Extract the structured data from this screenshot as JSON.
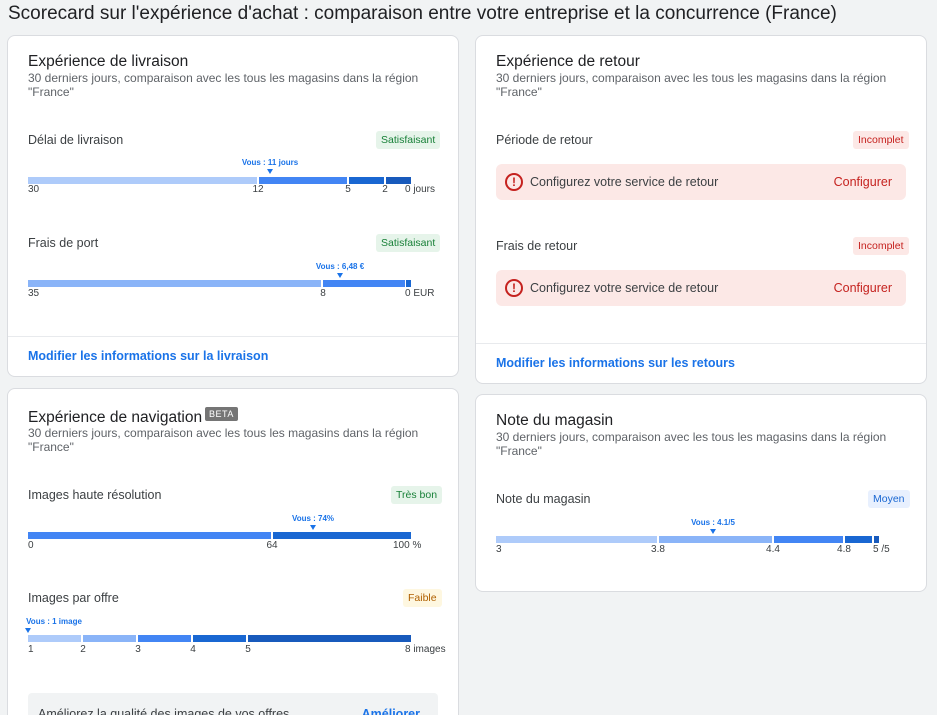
{
  "page_title": "Scorecard sur l'expérience d'achat : comparaison entre votre entreprise et la concurrence (France)",
  "colors": {
    "seg1": "#aecbfa",
    "seg2": "#8ab4f8",
    "seg3": "#4285f4",
    "seg4": "#1967d2",
    "seg5": "#185abc",
    "accent": "#1a73e8"
  },
  "delivery": {
    "title": "Expérience de livraison",
    "subtitle": "30 derniers jours, comparaison avec les tous les magasins dans la région \"France\"",
    "time": {
      "label": "Délai de livraison",
      "badge": "Satisfaisant",
      "you": "Vous : 11 jours",
      "ticks": [
        "30",
        "12",
        "5",
        "2",
        "0 jours"
      ]
    },
    "shipping": {
      "label": "Frais de port",
      "badge": "Satisfaisant",
      "you": "Vous : 6,48 €",
      "ticks": [
        "35",
        "8",
        "0 EUR"
      ]
    },
    "link": "Modifier les informations sur la livraison"
  },
  "returns": {
    "title": "Expérience de retour",
    "subtitle": "30 derniers jours, comparaison avec les tous les magasins dans la région \"France\"",
    "period": {
      "label": "Période de retour",
      "badge": "Incomplet",
      "alert": "Configurez votre service de retour",
      "action": "Configurer"
    },
    "fees": {
      "label": "Frais de retour",
      "badge": "Incomplet",
      "alert": "Configurez votre service de retour",
      "action": "Configurer"
    },
    "link": "Modifier les informations sur les retours"
  },
  "navigation": {
    "title": "Expérience de navigation",
    "beta": "BETA",
    "subtitle": "30 derniers jours, comparaison avec les tous les magasins dans la région \"France\"",
    "hires": {
      "label": "Images haute résolution",
      "badge": "Très bon",
      "you": "Vous : 74%",
      "ticks": [
        "0",
        "64",
        "100 %"
      ]
    },
    "per_offer": {
      "label": "Images par offre",
      "badge": "Faible",
      "you": "Vous : 1 image",
      "ticks": [
        "1",
        "2",
        "3",
        "4",
        "5",
        "8 images"
      ]
    },
    "improve_text": "Améliorez la qualité des images de vos offres",
    "improve_action": "Améliorer"
  },
  "store": {
    "title": "Note du magasin",
    "subtitle": "30 derniers jours, comparaison avec les tous les magasins dans la région \"France\"",
    "rating": {
      "label": "Note du magasin",
      "badge": "Moyen",
      "you": "Vous : 4.1/5",
      "ticks": [
        "3",
        "3.8",
        "4.4",
        "4.8",
        "5 /5"
      ]
    }
  }
}
